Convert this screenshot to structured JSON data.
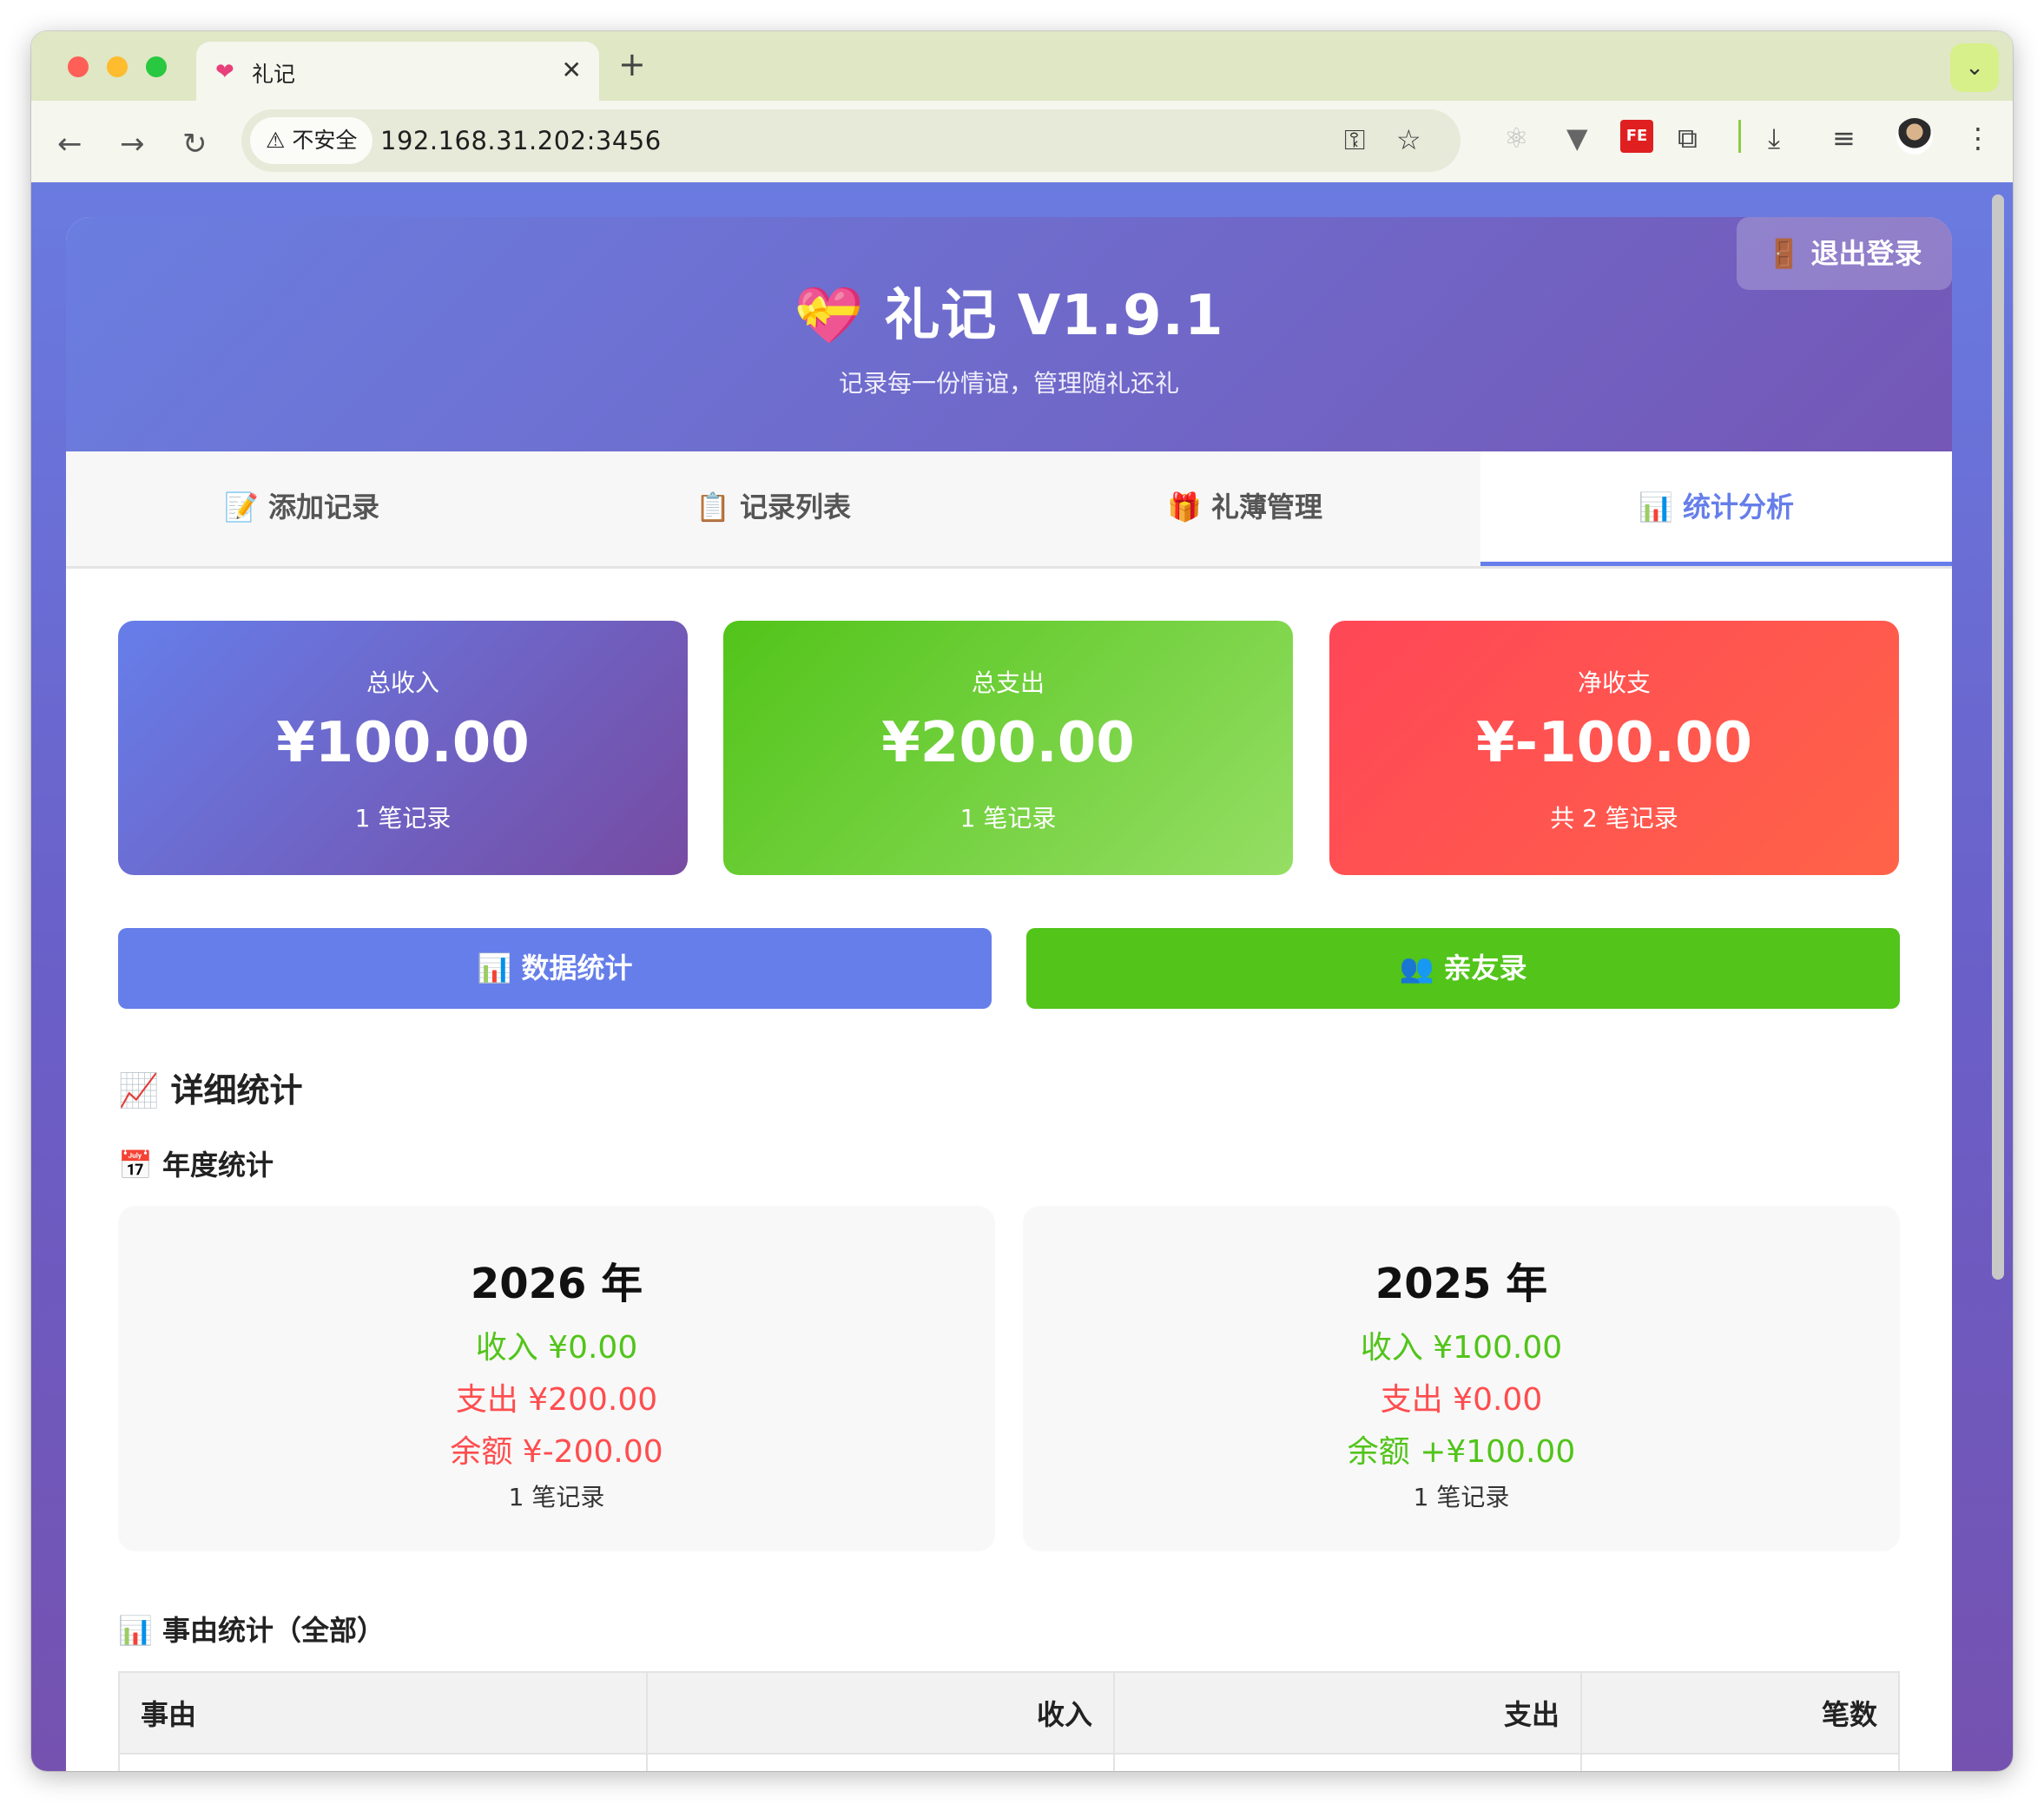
{
  "browser": {
    "tab_title": "礼记",
    "tab_favicon": "heart-gift-icon",
    "security_label": "不安全",
    "url": "192.168.31.202:3456"
  },
  "app": {
    "logout_label": "🚪 退出登录",
    "title": "💝 礼记 V1.9.1",
    "subtitle": "记录每一份情谊，管理随礼还礼",
    "tabs": [
      {
        "label": "📝 添加记录",
        "active": false
      },
      {
        "label": "📋 记录列表",
        "active": false
      },
      {
        "label": "🎁 礼薄管理",
        "active": false
      },
      {
        "label": "📊 统计分析",
        "active": true
      }
    ]
  },
  "summary": [
    {
      "label": "总收入",
      "amount": "¥100.00",
      "count": "1 笔记录",
      "colors": [
        "#667eea",
        "#764ba2"
      ]
    },
    {
      "label": "总支出",
      "amount": "¥200.00",
      "count": "1 笔记录",
      "colors": [
        "#52c41a",
        "#95de64"
      ]
    },
    {
      "label": "净收支",
      "amount": "¥-100.00",
      "count": "共 2 笔记录",
      "colors": [
        "#ff4757",
        "#ff6348"
      ]
    }
  ],
  "actions": {
    "data_stats": "📊 数据统计",
    "contacts": "👥 亲友录",
    "colors": {
      "data_stats": "#667eea",
      "contacts": "#52c41a"
    }
  },
  "detail": {
    "section_title": "📈 详细统计",
    "yearly_title": "📅 年度统计",
    "years": [
      {
        "year": "2026 年",
        "income": "收入 ¥0.00",
        "expense": "支出 ¥200.00",
        "balance": "余额 ¥-200.00",
        "balance_status": "negative",
        "count": "1 笔记录"
      },
      {
        "year": "2025 年",
        "income": "收入 ¥100.00",
        "expense": "支出 ¥0.00",
        "balance": "余额 +¥100.00",
        "balance_status": "positive",
        "count": "1 笔记录"
      }
    ],
    "reason_title": "📊 事由统计（全部）",
    "reason_table": {
      "headers": [
        "事由",
        "收入",
        "支出",
        "笔数"
      ]
    }
  },
  "colors": {
    "income": "#52c41a",
    "expense": "#ff4d4f",
    "accent": "#667eea"
  }
}
